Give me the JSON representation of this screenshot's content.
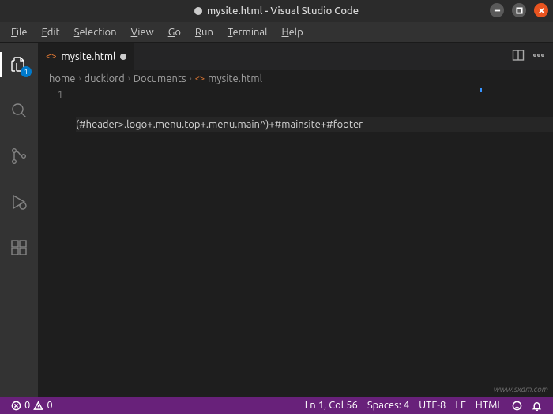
{
  "window": {
    "title": "mysite.html - Visual Studio Code",
    "dirty": true
  },
  "menubar": [
    {
      "m": "F",
      "rest": "ile"
    },
    {
      "m": "E",
      "rest": "dit"
    },
    {
      "m": "S",
      "rest": "election"
    },
    {
      "m": "V",
      "rest": "iew"
    },
    {
      "m": "G",
      "rest": "o"
    },
    {
      "m": "R",
      "rest": "un"
    },
    {
      "m": "T",
      "rest": "erminal"
    },
    {
      "m": "H",
      "rest": "elp"
    }
  ],
  "activitybar": {
    "explorer_badge": "1"
  },
  "tab": {
    "filename": "mysite.html"
  },
  "breadcrumbs": {
    "parts": [
      "home",
      "ducklord",
      "Documents"
    ],
    "file": "mysite.html"
  },
  "editor": {
    "line_numbers": [
      "1"
    ],
    "lines": [
      "(#header>.logo+.menu.top+.menu.main^)+#mainsite+#footer"
    ]
  },
  "statusbar": {
    "errors": "0",
    "warnings": "0",
    "cursor": "Ln 1, Col 56",
    "spaces": "Spaces: 4",
    "encoding": "UTF-8",
    "eol": "LF",
    "lang": "HTML"
  },
  "watermark": "www.sxdm.com"
}
